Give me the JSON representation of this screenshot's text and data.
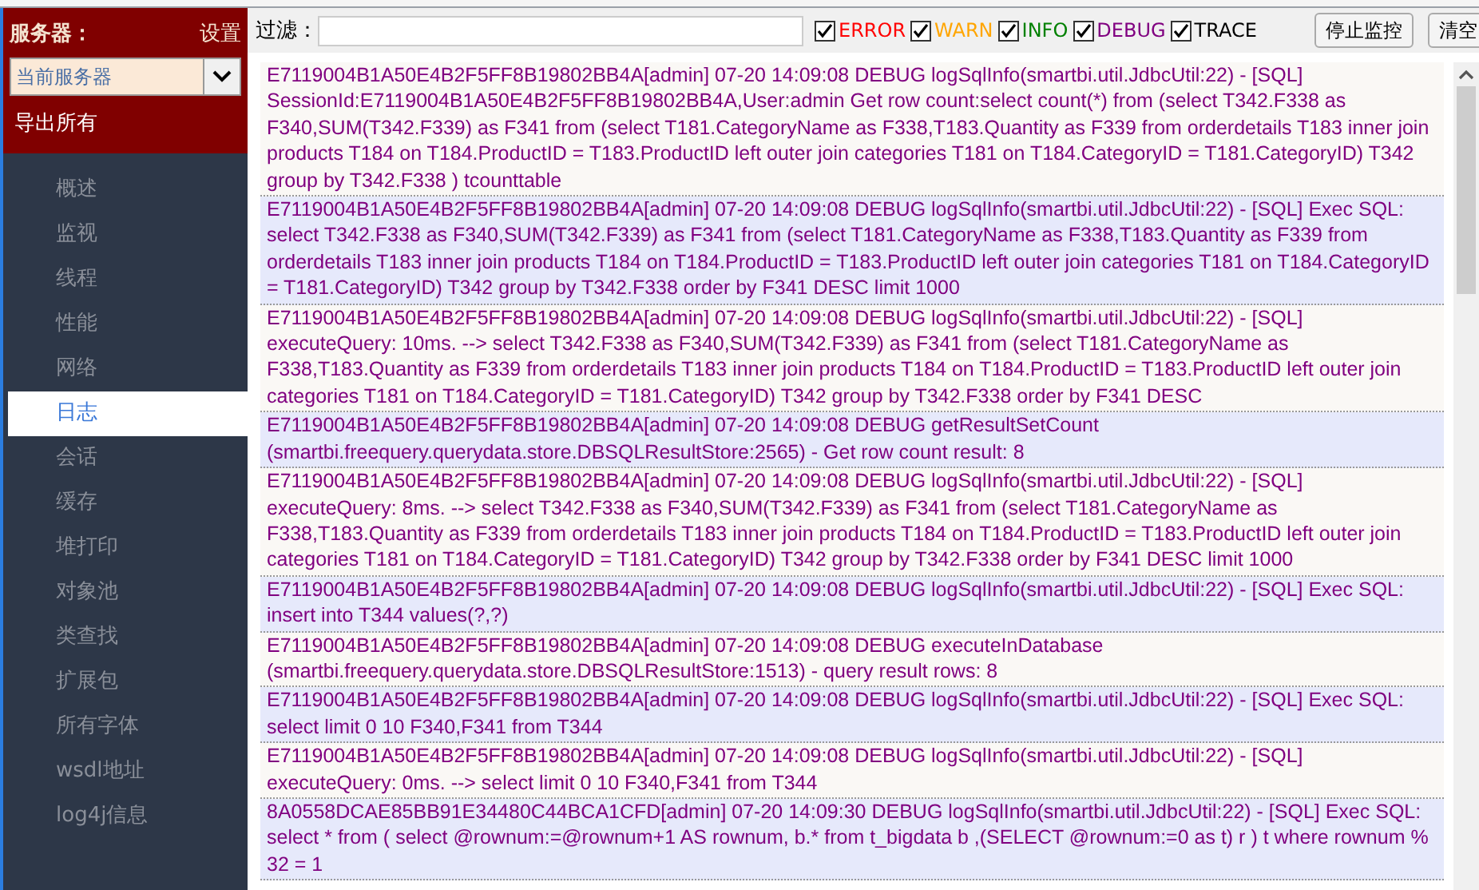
{
  "sidebar": {
    "server_label": "服务器：",
    "settings_link": "设置",
    "server_select": {
      "value": "当前服务器"
    },
    "export_link": "导出所有",
    "items": [
      {
        "label": "概述",
        "selected": false
      },
      {
        "label": "监视",
        "selected": false
      },
      {
        "label": "线程",
        "selected": false
      },
      {
        "label": "性能",
        "selected": false
      },
      {
        "label": "网络",
        "selected": false
      },
      {
        "label": "日志",
        "selected": true
      },
      {
        "label": "会话",
        "selected": false
      },
      {
        "label": "缓存",
        "selected": false
      },
      {
        "label": "堆打印",
        "selected": false
      },
      {
        "label": "对象池",
        "selected": false
      },
      {
        "label": "类查找",
        "selected": false
      },
      {
        "label": "扩展包",
        "selected": false
      },
      {
        "label": "所有字体",
        "selected": false
      },
      {
        "label": "wsdl地址",
        "selected": false
      },
      {
        "label": "log4j信息",
        "selected": false
      }
    ]
  },
  "toolbar": {
    "filter_label": "过滤：",
    "levels": [
      {
        "label": "ERROR",
        "checked": true,
        "color": "#ff0000"
      },
      {
        "label": "WARN",
        "checked": true,
        "color": "#ffa500"
      },
      {
        "label": "INFO",
        "checked": true,
        "color": "#008000"
      },
      {
        "label": "DEBUG",
        "checked": true,
        "color": "#800080"
      },
      {
        "label": "TRACE",
        "checked": true,
        "color": "#000000"
      }
    ],
    "buttons": [
      "停止监控",
      "清空"
    ]
  },
  "log": [
    "E7119004B1A50E4B2F5FF8B19802BB4A[admin] 07-20 14:09:08 DEBUG logSqlInfo(smartbi.util.JdbcUtil:22) - [SQL] SessionId:E7119004B1A50E4B2F5FF8B19802BB4A,User:admin Get row count:select count(*) from (select T342.F338 as F340,SUM(T342.F339) as F341 from (select T181.CategoryName as F338,T183.Quantity as F339 from orderdetails T183 inner join products T184 on T184.ProductID = T183.ProductID left outer join categories T181 on T184.CategoryID = T181.CategoryID) T342 group by T342.F338 ) tcounttable",
    "E7119004B1A50E4B2F5FF8B19802BB4A[admin] 07-20 14:09:08 DEBUG logSqlInfo(smartbi.util.JdbcUtil:22) - [SQL] Exec SQL: select T342.F338 as F340,SUM(T342.F339) as F341 from (select T181.CategoryName as F338,T183.Quantity as F339 from orderdetails T183 inner join products T184 on T184.ProductID = T183.ProductID left outer join categories T181 on T184.CategoryID = T181.CategoryID) T342 group by T342.F338 order by F341 DESC limit 1000",
    "E7119004B1A50E4B2F5FF8B19802BB4A[admin] 07-20 14:09:08 DEBUG logSqlInfo(smartbi.util.JdbcUtil:22) - [SQL] executeQuery: 10ms. --> select T342.F338 as F340,SUM(T342.F339) as F341 from (select T181.CategoryName as F338,T183.Quantity as F339 from orderdetails T183 inner join products T184 on T184.ProductID = T183.ProductID left outer join categories T181 on T184.CategoryID = T181.CategoryID) T342 group by T342.F338 order by F341 DESC",
    "E7119004B1A50E4B2F5FF8B19802BB4A[admin] 07-20 14:09:08 DEBUG getResultSetCount (smartbi.freequery.querydata.store.DBSQLResultStore:2565) - Get row count result: 8",
    "E7119004B1A50E4B2F5FF8B19802BB4A[admin] 07-20 14:09:08 DEBUG logSqlInfo(smartbi.util.JdbcUtil:22) - [SQL] executeQuery: 8ms. --> select T342.F338 as F340,SUM(T342.F339) as F341 from (select T181.CategoryName as F338,T183.Quantity as F339 from orderdetails T183 inner join products T184 on T184.ProductID = T183.ProductID left outer join categories T181 on T184.CategoryID = T181.CategoryID) T342 group by T342.F338 order by F341 DESC limit 1000",
    "E7119004B1A50E4B2F5FF8B19802BB4A[admin] 07-20 14:09:08 DEBUG logSqlInfo(smartbi.util.JdbcUtil:22) - [SQL] Exec SQL: insert into T344 values(?,?)",
    "E7119004B1A50E4B2F5FF8B19802BB4A[admin] 07-20 14:09:08 DEBUG executeInDatabase (smartbi.freequery.querydata.store.DBSQLResultStore:1513) - query result rows: 8",
    "E7119004B1A50E4B2F5FF8B19802BB4A[admin] 07-20 14:09:08 DEBUG logSqlInfo(smartbi.util.JdbcUtil:22) - [SQL] Exec SQL: select limit 0 10 F340,F341 from T344",
    "E7119004B1A50E4B2F5FF8B19802BB4A[admin] 07-20 14:09:08 DEBUG logSqlInfo(smartbi.util.JdbcUtil:22) - [SQL] executeQuery: 0ms. --> select limit 0 10 F340,F341 from T344",
    "8A0558DCAE85BB91E34480C44BCA1CFD[admin] 07-20 14:09:30 DEBUG logSqlInfo(smartbi.util.JdbcUtil:22) - [SQL] Exec SQL: select * from ( select @rownum:=@rownum+1 AS rownum, b.* from t_bigdata b ,(SELECT @rownum:=0 as t) r ) t where rownum % 32 = 1"
  ]
}
